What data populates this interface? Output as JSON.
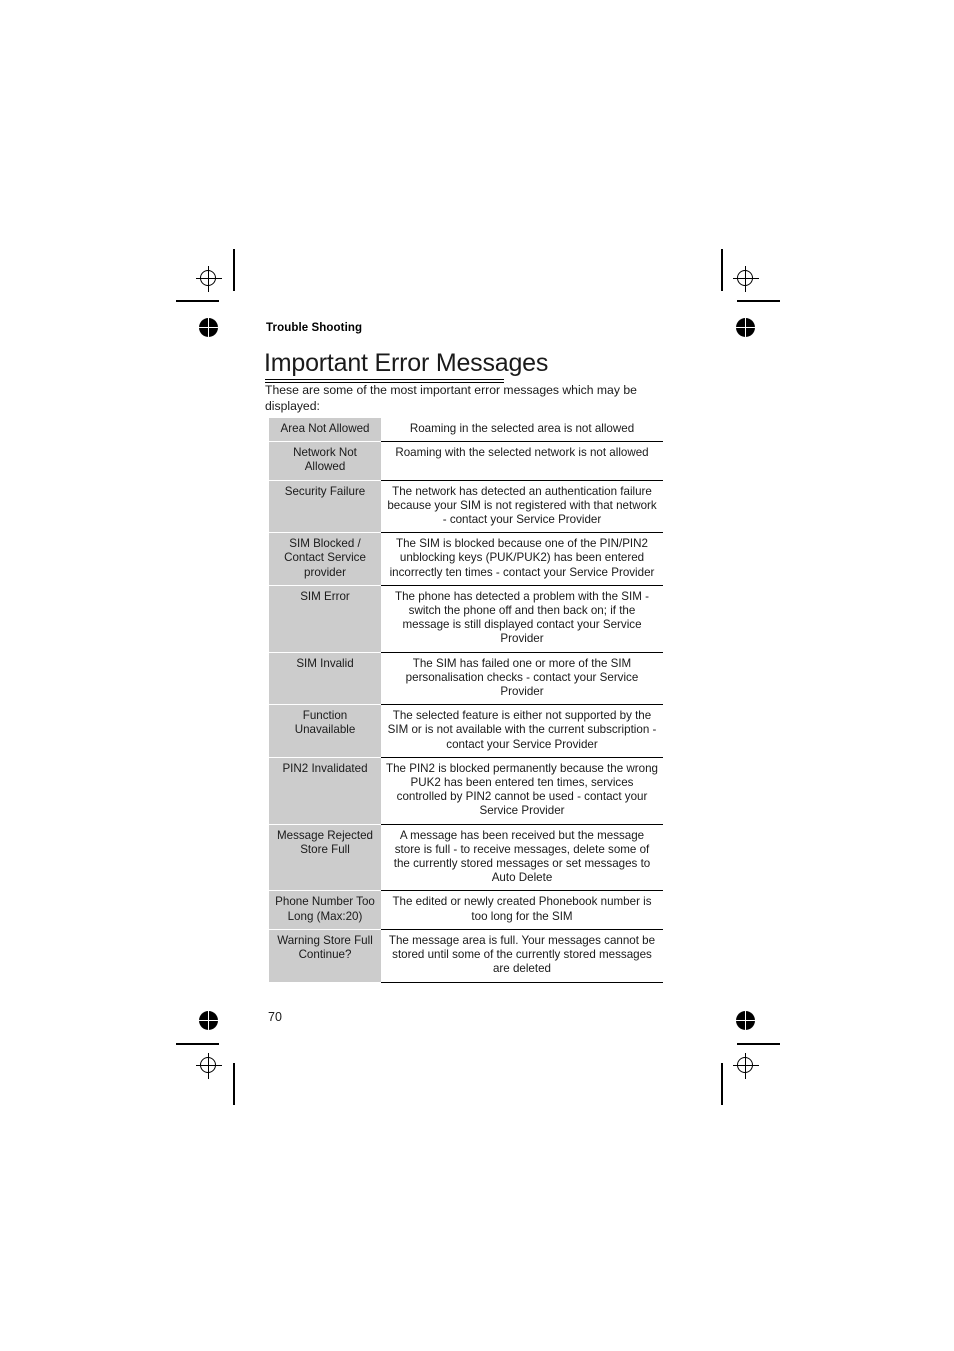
{
  "document": {
    "running_head": "Trouble Shooting",
    "title": "Important Error Messages",
    "intro": "These are some of the most important error messages which may be displayed:",
    "page_number": "70"
  },
  "table": {
    "rows": [
      {
        "key": "Area Not Allowed",
        "value": "Roaming in the selected area is not allowed"
      },
      {
        "key": "Network Not Allowed",
        "value": "Roaming with the selected network is not allowed"
      },
      {
        "key": "Security Failure",
        "value": "The network has detected an authentication failure because your SIM is not registered with that network - contact your Service Provider"
      },
      {
        "key": "SIM Blocked / Contact Service provider",
        "value": "The SIM is blocked because one of the PIN/PIN2 unblocking keys (PUK/PUK2) has been entered incorrectly ten times - contact your Service Provider"
      },
      {
        "key": "SIM Error",
        "value": "The phone has detected a problem with the SIM - switch the phone off and then back on; if the message is still displayed contact your Service Provider"
      },
      {
        "key": "SIM Invalid",
        "value": "The SIM has failed one or more of the SIM personalisation checks - contact your Service Provider"
      },
      {
        "key": "Function Unavailable",
        "value": "The selected feature is either not supported by the SIM or is not available with the current subscription - contact your Service Provider"
      },
      {
        "key": "PIN2 Invalidated",
        "value": "The PIN2 is blocked permanently because the wrong PUK2 has been entered ten times, services controlled by PIN2 cannot be used - contact your Service Provider"
      },
      {
        "key": "Message Rejected Store Full",
        "value": "A message has been received but the message store is full - to receive messages, delete some of the currently stored messages or set messages to Auto Delete"
      },
      {
        "key": "Phone Number Too Long (Max:20)",
        "value": "The edited or newly created Phonebook number is too long for the SIM"
      },
      {
        "key": "Warning Store Full Continue?",
        "value": "The message area is full. Your messages cannot be stored until some of the currently stored messages are deleted"
      }
    ]
  },
  "print_marks": {
    "registration_target_icon": "registration-crosshair-icon",
    "registration_pie_icon": "registration-pie-icon",
    "crop_mark": "crop-mark"
  },
  "colors": {
    "key_cell_background": "#cccccc",
    "text": "#1a1a1a",
    "rule": "#000000",
    "page_background": "#ffffff"
  }
}
